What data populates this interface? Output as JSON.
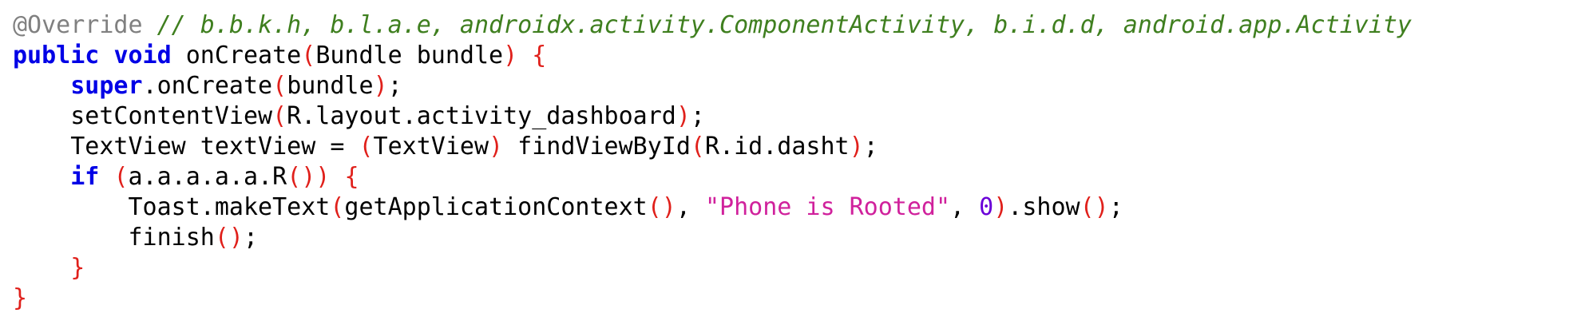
{
  "colors": {
    "background": "#ffffff",
    "default_text": "#000000",
    "annotation": "#808080",
    "comment": "#3f7f1f",
    "keyword": "#0000e6",
    "punctuation": "#e0201b",
    "string": "#d0219c",
    "number": "#6a00d8"
  },
  "code": {
    "lines": [
      [
        {
          "t": "annotation",
          "v": "@Override"
        },
        {
          "t": "ident",
          "v": " "
        },
        {
          "t": "comment",
          "v": "// b.b.k.h, b.l.a.e, androidx.activity.ComponentActivity, b.i.d.d, android.app.Activity"
        }
      ],
      [
        {
          "t": "keyword",
          "v": "public"
        },
        {
          "t": "ident",
          "v": " "
        },
        {
          "t": "keyword",
          "v": "void"
        },
        {
          "t": "ident",
          "v": " onCreate"
        },
        {
          "t": "punct",
          "v": "("
        },
        {
          "t": "ident",
          "v": "Bundle bundle"
        },
        {
          "t": "punct",
          "v": ")"
        },
        {
          "t": "ident",
          "v": " "
        },
        {
          "t": "punct",
          "v": "{"
        }
      ],
      [
        {
          "t": "ident",
          "v": "    "
        },
        {
          "t": "keyword",
          "v": "super"
        },
        {
          "t": "ident",
          "v": ".onCreate"
        },
        {
          "t": "punct",
          "v": "("
        },
        {
          "t": "ident",
          "v": "bundle"
        },
        {
          "t": "punct",
          "v": ")"
        },
        {
          "t": "ident",
          "v": ";"
        }
      ],
      [
        {
          "t": "ident",
          "v": "    setContentView"
        },
        {
          "t": "punct",
          "v": "("
        },
        {
          "t": "ident",
          "v": "R.layout.activity_dashboard"
        },
        {
          "t": "punct",
          "v": ")"
        },
        {
          "t": "ident",
          "v": ";"
        }
      ],
      [
        {
          "t": "ident",
          "v": "    TextView textView = "
        },
        {
          "t": "punct",
          "v": "("
        },
        {
          "t": "ident",
          "v": "TextView"
        },
        {
          "t": "punct",
          "v": ")"
        },
        {
          "t": "ident",
          "v": " findViewById"
        },
        {
          "t": "punct",
          "v": "("
        },
        {
          "t": "ident",
          "v": "R.id.dasht"
        },
        {
          "t": "punct",
          "v": ")"
        },
        {
          "t": "ident",
          "v": ";"
        }
      ],
      [
        {
          "t": "ident",
          "v": "    "
        },
        {
          "t": "keyword",
          "v": "if"
        },
        {
          "t": "ident",
          "v": " "
        },
        {
          "t": "punct",
          "v": "("
        },
        {
          "t": "ident",
          "v": "a.a.a.a.a.R"
        },
        {
          "t": "punct",
          "v": "())"
        },
        {
          "t": "ident",
          "v": " "
        },
        {
          "t": "punct",
          "v": "{"
        }
      ],
      [
        {
          "t": "ident",
          "v": "        Toast.makeText"
        },
        {
          "t": "punct",
          "v": "("
        },
        {
          "t": "ident",
          "v": "getApplicationContext"
        },
        {
          "t": "punct",
          "v": "()"
        },
        {
          "t": "ident",
          "v": ", "
        },
        {
          "t": "string",
          "v": "\"Phone is Rooted\""
        },
        {
          "t": "ident",
          "v": ", "
        },
        {
          "t": "number",
          "v": "0"
        },
        {
          "t": "punct",
          "v": ")"
        },
        {
          "t": "ident",
          "v": ".show"
        },
        {
          "t": "punct",
          "v": "()"
        },
        {
          "t": "ident",
          "v": ";"
        }
      ],
      [
        {
          "t": "ident",
          "v": "        finish"
        },
        {
          "t": "punct",
          "v": "()"
        },
        {
          "t": "ident",
          "v": ";"
        }
      ],
      [
        {
          "t": "ident",
          "v": "    "
        },
        {
          "t": "punct",
          "v": "}"
        }
      ],
      [
        {
          "t": "punct",
          "v": "}"
        }
      ]
    ]
  }
}
